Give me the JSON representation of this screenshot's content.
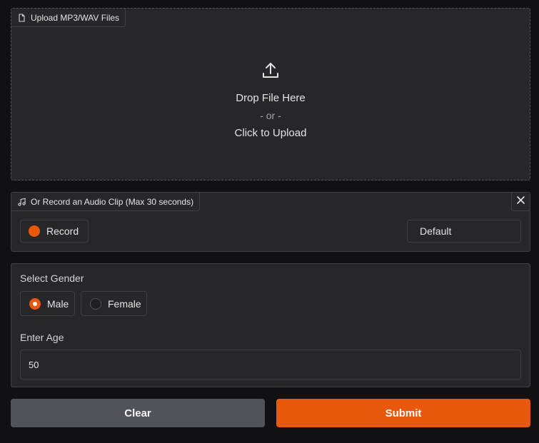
{
  "upload": {
    "label": "Upload MP3/WAV Files",
    "drop_text": "Drop File Here",
    "or_text": "- or -",
    "click_text": "Click to Upload",
    "label_icon": "file-icon",
    "main_icon": "upload-icon"
  },
  "record": {
    "label": "Or Record an Audio Clip (Max 30 seconds)",
    "label_icon": "music-note-icon",
    "record_label": "Record",
    "device_value": "Default",
    "close_icon": "close-icon"
  },
  "form": {
    "gender_label": "Select Gender",
    "gender_options": [
      {
        "label": "Male",
        "selected": true
      },
      {
        "label": "Female",
        "selected": false
      }
    ],
    "age_label": "Enter Age",
    "age_value": "50"
  },
  "actions": {
    "clear_label": "Clear",
    "submit_label": "Submit"
  },
  "colors": {
    "accent": "#ea580c",
    "background": "#111113",
    "panel": "#27272a",
    "secondary_button": "#52525b"
  }
}
